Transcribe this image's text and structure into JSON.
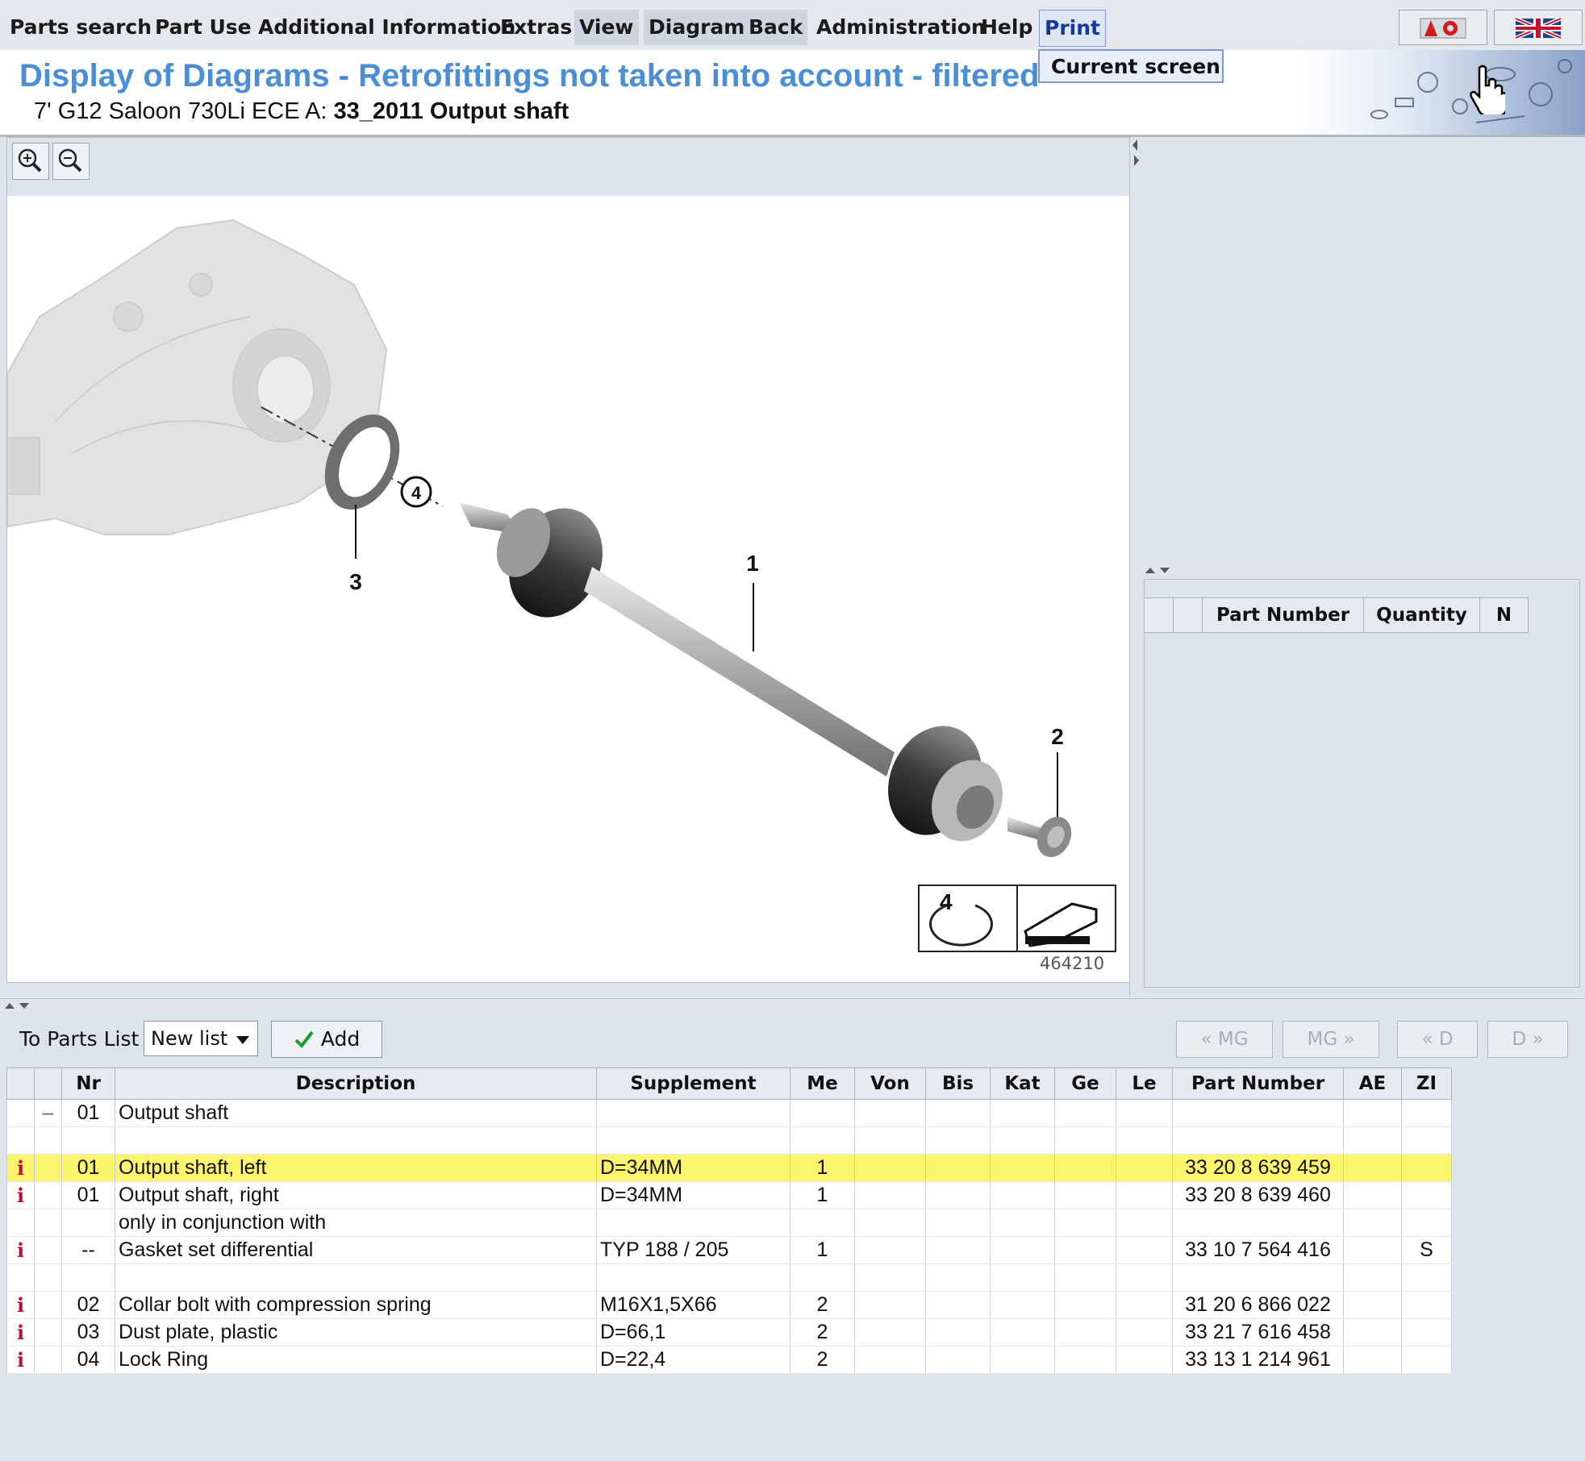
{
  "menu": {
    "items": [
      "Parts search",
      "Part Use",
      "Additional Information",
      "Extras",
      "View",
      "Diagram",
      "Back",
      "Administration",
      "Help",
      "Print"
    ],
    "print_dropdown": "Current screen"
  },
  "header": {
    "title": "Display of Diagrams - Retrofittings not taken into account - filtered",
    "subtitle_prefix": "7' G12 Saloon 730Li ECE  A:",
    "subtitle_bold": "33_2011 Output shaft"
  },
  "diagram": {
    "callouts": [
      "1",
      "2",
      "3",
      "4"
    ],
    "ring_label": "4",
    "image_id": "464210"
  },
  "right_table": {
    "headers": [
      "",
      "",
      "Part Number",
      "Quantity",
      "N"
    ]
  },
  "parts_toolbar": {
    "to_parts_list_label": "To Parts List",
    "list_select_value": "New list",
    "add_label": "Add",
    "nav": [
      "« MG",
      "MG »",
      "« D",
      "D »"
    ]
  },
  "parts_table": {
    "headers": [
      "",
      "",
      "Nr",
      "Description",
      "Supplement",
      "Me",
      "Von",
      "Bis",
      "Kat",
      "Ge",
      "Le",
      "Part Number",
      "AE",
      "ZI"
    ],
    "rows": [
      {
        "info": "",
        "ctrl": "–",
        "nr": "01",
        "desc": "Output shaft",
        "supp": "",
        "me": "",
        "pn": "",
        "zi": ""
      },
      {
        "info": "",
        "ctrl": "",
        "nr": "",
        "desc": "",
        "supp": "",
        "me": "",
        "pn": "",
        "zi": ""
      },
      {
        "info": "i",
        "ctrl": "",
        "nr": "01",
        "desc": "Output shaft, left",
        "supp": "D=34MM",
        "me": "1",
        "pn": "33 20 8 639 459",
        "zi": "",
        "selected": true
      },
      {
        "info": "i",
        "ctrl": "",
        "nr": "01",
        "desc": "Output shaft, right",
        "supp": "D=34MM",
        "me": "1",
        "pn": "33 20 8 639 460",
        "zi": ""
      },
      {
        "info": "",
        "ctrl": "",
        "nr": "",
        "desc": "only in conjunction with",
        "supp": "",
        "me": "",
        "pn": "",
        "zi": ""
      },
      {
        "info": "i",
        "ctrl": "",
        "nr": "--",
        "desc": "Gasket set differential",
        "supp": "TYP 188 / 205",
        "me": "1",
        "pn": "33 10 7 564 416",
        "zi": "S"
      },
      {
        "info": "",
        "ctrl": "",
        "nr": "",
        "desc": "",
        "supp": "",
        "me": "",
        "pn": "",
        "zi": ""
      },
      {
        "info": "i",
        "ctrl": "",
        "nr": "02",
        "desc": "Collar bolt with compression spring",
        "supp": "M16X1,5X66",
        "me": "2",
        "pn": "31 20 6 866 022",
        "zi": ""
      },
      {
        "info": "i",
        "ctrl": "",
        "nr": "03",
        "desc": "Dust plate, plastic",
        "supp": "D=66,1",
        "me": "2",
        "pn": "33 21 7 616 458",
        "zi": ""
      },
      {
        "info": "i",
        "ctrl": "",
        "nr": "04",
        "desc": "Lock Ring",
        "supp": "D=22,4",
        "me": "2",
        "pn": "33 13 1 214 961",
        "zi": ""
      }
    ]
  }
}
